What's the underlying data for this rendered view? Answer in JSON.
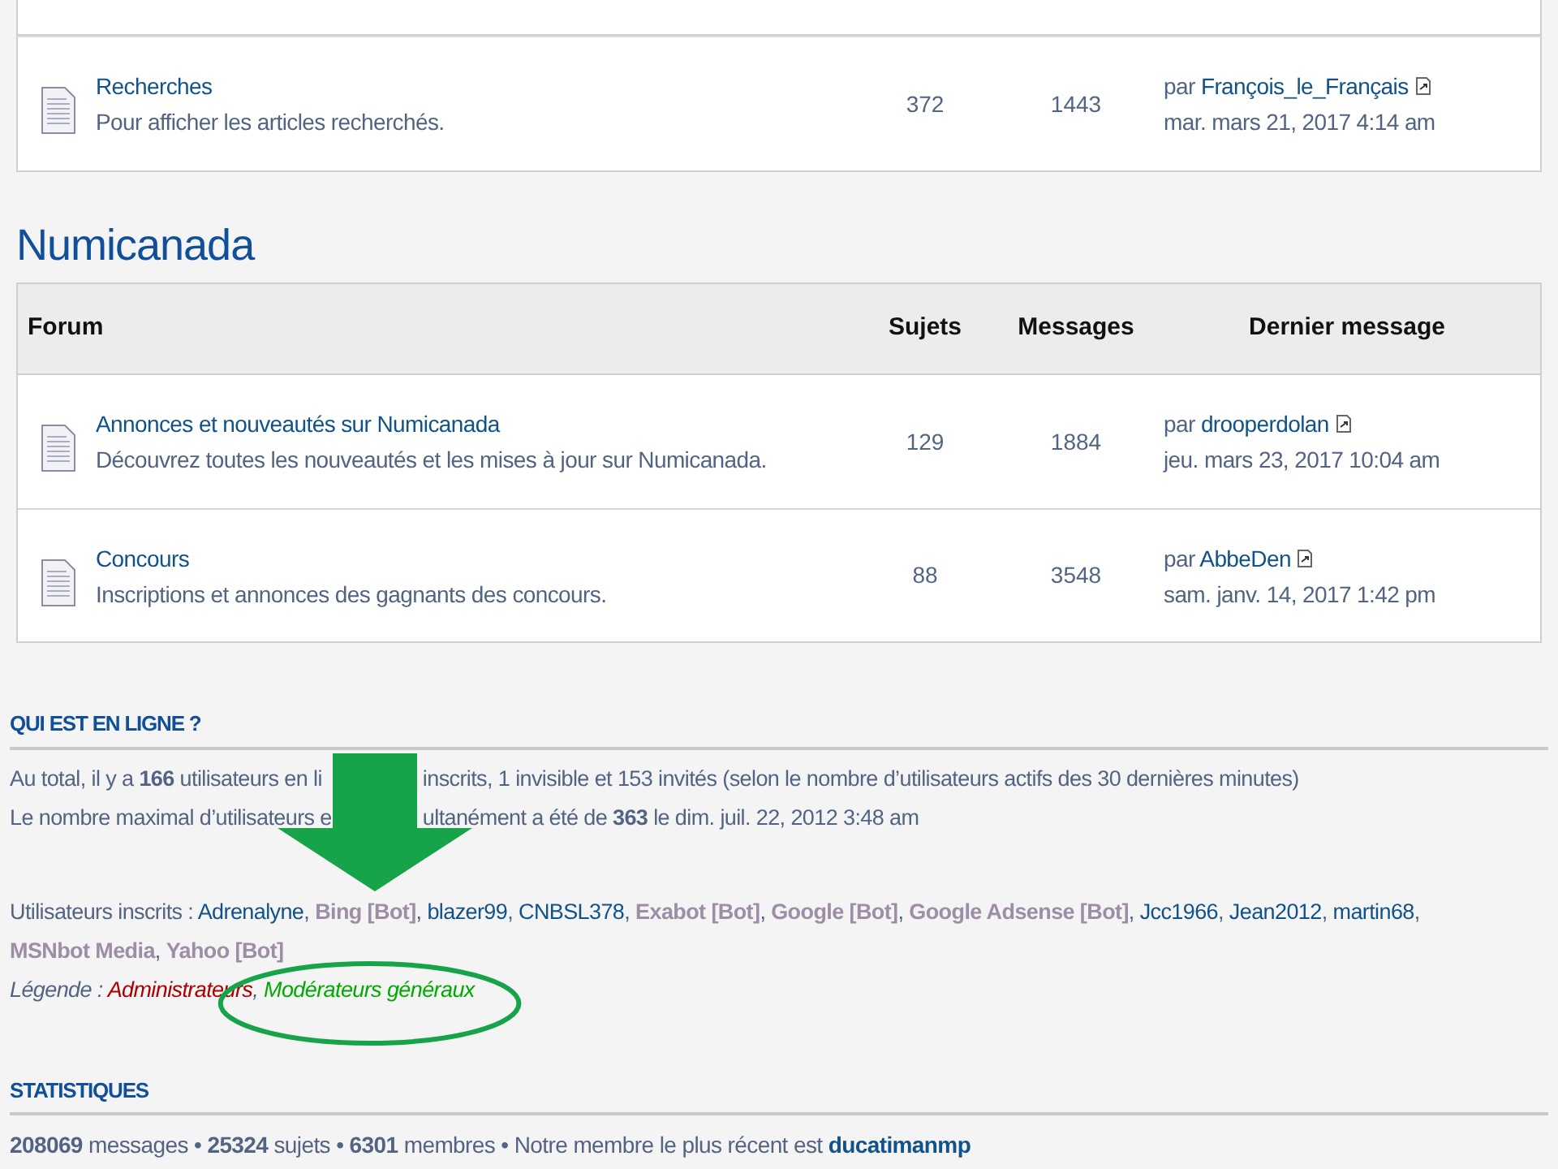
{
  "top_table": {
    "rows": [
      {
        "title": "Recherches",
        "description": "Pour afficher les articles recherchés.",
        "topics": "372",
        "posts": "1443",
        "last_by": "par",
        "last_author": "François_le_Français",
        "last_date": "mar. mars 21, 2017 4:14 am"
      }
    ]
  },
  "category": {
    "title": "Numicanada",
    "columns": [
      "Forum",
      "Sujets",
      "Messages",
      "Dernier message"
    ],
    "rows": [
      {
        "title": "Annonces et nouveautés sur Numicanada",
        "description": "Découvrez toutes les nouveautés et les mises à jour sur Numicanada.",
        "topics": "129",
        "posts": "1884",
        "last_by": "par",
        "last_author": "drooperdolan",
        "last_date": "jeu. mars 23, 2017 10:04 am"
      },
      {
        "title": "Concours",
        "description": "Inscriptions et annonces des gagnants des concours.",
        "topics": "88",
        "posts": "3548",
        "last_by": "par",
        "last_author": "AbbeDen",
        "last_date": "sam. janv. 14, 2017 1:42 pm"
      }
    ]
  },
  "online": {
    "heading": "QUI EST EN LIGNE ?",
    "lines": [
      {
        "before": "Au total, il y a **166** utilisateurs en li",
        "after": "inscrits, 1 invisible et 153 invités (selon le nombre d’utilisateurs actifs des 30 dernières minutes)"
      },
      {
        "before": "Le nombre maximal d’utilisateurs e",
        "after": "ultanément a été de **363** le dim. juil. 22, 2012 3:48 am"
      }
    ],
    "users_label": "Utilisateurs inscrits :",
    "users": [
      {
        "name": "Adrenalyne",
        "kind": "user",
        "color": "#105289",
        "separator": ","
      },
      {
        "name": "Bing [Bot]",
        "kind": "bot",
        "color": "#9e8da7",
        "separator": ","
      },
      {
        "name": "blazer99",
        "kind": "user",
        "color": "#105289",
        "separator": ","
      },
      {
        "name": "CNBSL378",
        "kind": "user",
        "color": "#105289",
        "separator": ","
      },
      {
        "name": "Exabot [Bot]",
        "kind": "bot",
        "color": "#9e8da7",
        "separator": ","
      },
      {
        "name": "Google [Bot]",
        "kind": "bot",
        "color": "#9e8da7",
        "separator": ","
      },
      {
        "name": "Google Adsense [Bot]",
        "kind": "bot",
        "color": "#9e8da7",
        "separator": ","
      },
      {
        "name": "Jcc1966",
        "kind": "user",
        "color": "#105289",
        "separator": ","
      },
      {
        "name": "Jean2012",
        "kind": "user",
        "color": "#105289",
        "separator": ","
      },
      {
        "name": "martin68",
        "kind": "user",
        "color": "#105289",
        "separator": ","
      },
      {
        "name": "MSNbot Media",
        "kind": "bot",
        "color": "#9e8da7",
        "separator": ","
      },
      {
        "name": "Yahoo [Bot]",
        "kind": "bot",
        "color": "#9e8da7"
      }
    ],
    "legend_label": "Légende :",
    "legend": [
      {
        "name": "Administrateurs",
        "color": "#aa0000",
        "separator": ","
      },
      {
        "name": "Modérateurs généraux",
        "color": "#00aa00"
      }
    ]
  },
  "statistics": {
    "heading": "STATISTIQUES",
    "summary": "**208069** messages • **25324** sujets • **6301** membres • Notre membre le plus récent est",
    "newest_member": "ducatimanmp"
  }
}
